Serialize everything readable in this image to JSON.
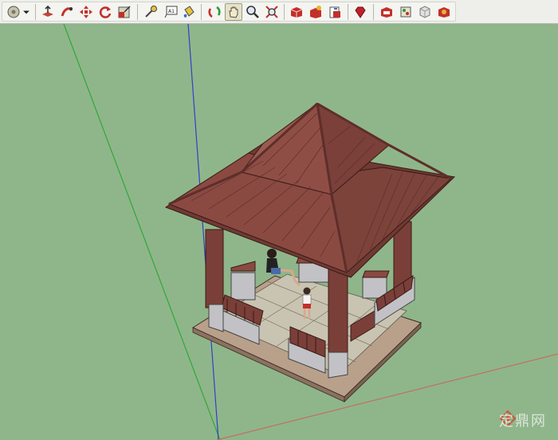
{
  "toolbar": {
    "tools": [
      {
        "name": "select-tool",
        "icon": "select-circle-icon"
      },
      {
        "name": "select-dropdown",
        "icon": "dropdown-arrow-icon"
      },
      {
        "name": "push-pull-tool",
        "icon": "push-pull-icon"
      },
      {
        "name": "follow-me-tool",
        "icon": "follow-me-icon"
      },
      {
        "name": "move-tool",
        "icon": "move-icon"
      },
      {
        "name": "rotate-tool",
        "icon": "rotate-icon"
      },
      {
        "name": "scale-tool",
        "icon": "scale-icon"
      },
      {
        "name": "tape-measure-tool",
        "icon": "tape-measure-icon"
      },
      {
        "name": "text-tool",
        "icon": "text-icon",
        "label": "A1"
      },
      {
        "name": "paint-bucket-tool",
        "icon": "paint-bucket-icon"
      },
      {
        "name": "orbit-tool",
        "icon": "orbit-icon"
      },
      {
        "name": "pan-tool",
        "icon": "pan-hand-icon",
        "active": true
      },
      {
        "name": "zoom-tool",
        "icon": "zoom-icon"
      },
      {
        "name": "zoom-extents-tool",
        "icon": "zoom-extents-icon"
      },
      {
        "name": "get-models-button",
        "icon": "warehouse-icon"
      },
      {
        "name": "share-model-button",
        "icon": "share-model-icon"
      },
      {
        "name": "share-component-button",
        "icon": "share-component-icon"
      },
      {
        "name": "ruby-button",
        "icon": "ruby-icon"
      },
      {
        "name": "components-button",
        "icon": "components-icon"
      },
      {
        "name": "materials-button",
        "icon": "materials-icon"
      },
      {
        "name": "styles-button",
        "icon": "styles-icon"
      },
      {
        "name": "layers-button",
        "icon": "layers-icon"
      }
    ]
  },
  "colors": {
    "background": "#8fb68a",
    "roof": "#8a4a42",
    "roof_dark": "#5e2e2a",
    "post": "#7a3f38",
    "floor": "#c9c4b2",
    "base": "#b9a08a",
    "stone": "#c2c2c6",
    "axis_green": "#2fa83a",
    "axis_blue": "#3140c8",
    "axis_red": "#c07064"
  },
  "watermark": {
    "text": "定鼎网",
    "icon": "dingding-logo-icon"
  }
}
